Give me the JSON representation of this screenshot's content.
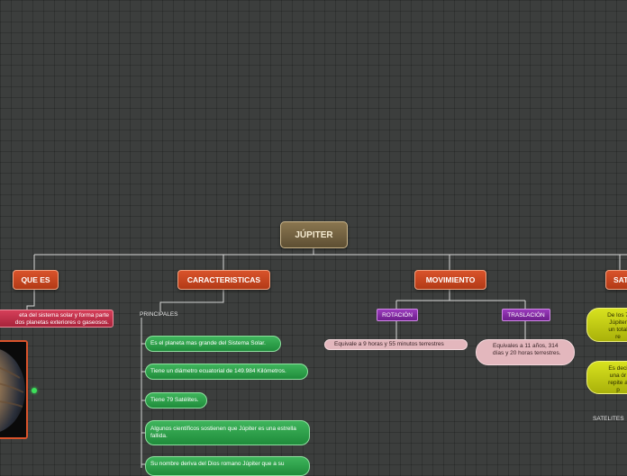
{
  "root": {
    "label": "JÚPITER"
  },
  "categories": {
    "que_es": "QUE ES",
    "caracteristicas": "CARACTERISTICAS",
    "movimiento": "MOVIMIENTO",
    "satelites": "SAT"
  },
  "que_es": {
    "text_line1": "eta del sistema solar y forma parte",
    "text_line2": "dos planetas exteriores o gaseosos."
  },
  "caracteristicas": {
    "principales_label": "PRINCIPALES",
    "items": [
      "Es el planeta mas grande del Sistema Solar.",
      "Tiene un diámetro ecuatorial de 149.984 Kilómetros.",
      "Tiene 79 Satélites.",
      "Algunos científicos sostienen que Júpiter es una estrella fallida.",
      "Su nombre deriva del Dios romano Júpiter que a su"
    ]
  },
  "movimiento": {
    "rotacion": {
      "label": "ROTACIÓN",
      "detail": "Equivale a 9 horas y 55 minutos terrestres"
    },
    "traslacion": {
      "label": "TRASLACIÓN",
      "detail": "Equivales a 11 años, 314 días y 20 horas terrestres."
    }
  },
  "satelites": {
    "bubble1": [
      "De los 7",
      "Júpiter",
      "un total",
      "re"
    ],
    "bubble2": [
      "Es deci",
      "una ór",
      "repite a",
      "p"
    ],
    "label": "SATELITES"
  },
  "colors": {
    "background": "#3c3e3d",
    "root": "#7a6745",
    "category": "#c8441f",
    "green_node": "#2ea24c",
    "purple_node": "#832aa5",
    "yellow_node": "#c3cc14",
    "pink_node": "#c0304a"
  }
}
